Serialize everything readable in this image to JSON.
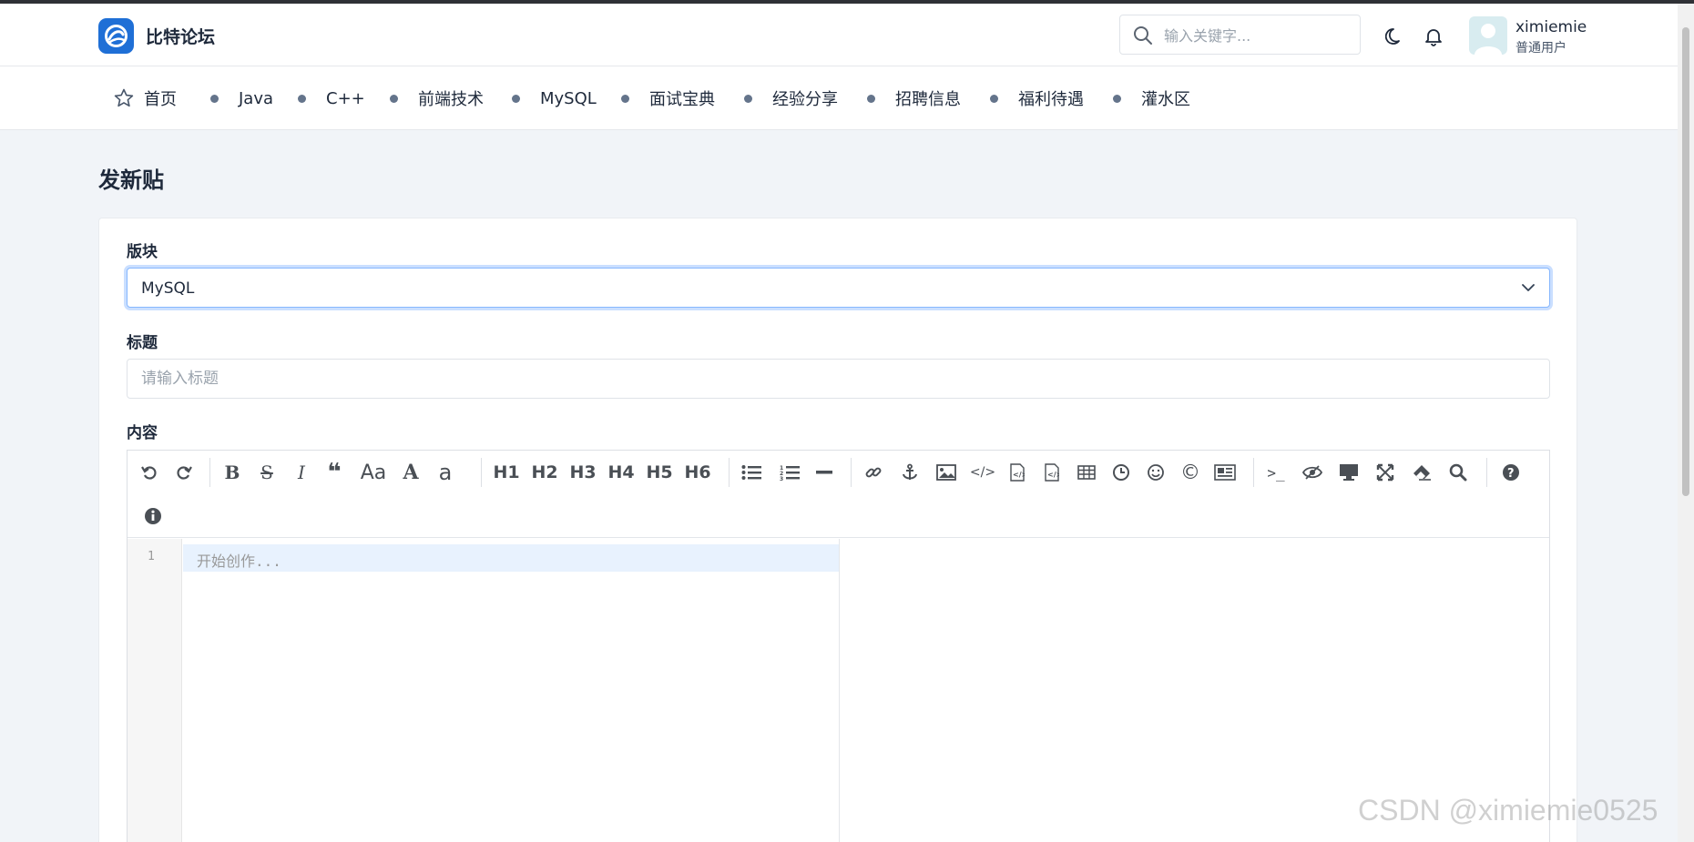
{
  "header": {
    "brand": "比特论坛",
    "search_placeholder": "输入关键字...",
    "user": {
      "name": "ximiemie",
      "role": "普通用户"
    }
  },
  "nav": {
    "items": [
      {
        "label": "首页",
        "icon": "star-icon"
      },
      {
        "label": "Java"
      },
      {
        "label": "C++"
      },
      {
        "label": "前端技术"
      },
      {
        "label": "MySQL"
      },
      {
        "label": "面试宝典"
      },
      {
        "label": "经验分享"
      },
      {
        "label": "招聘信息"
      },
      {
        "label": "福利待遇"
      },
      {
        "label": "灌水区"
      }
    ]
  },
  "page": {
    "title": "发新贴"
  },
  "form": {
    "board_label": "版块",
    "board_value": "MySQL",
    "title_label": "标题",
    "title_placeholder": "请输入标题",
    "content_label": "内容",
    "editor": {
      "line_number": "1",
      "placeholder": "开始创作...",
      "toolbar": [
        "undo",
        "redo",
        "bold",
        "strikethrough",
        "italic",
        "quote",
        "uppercase",
        "lowercase-a",
        "lowercase",
        "h1",
        "h2",
        "h3",
        "h4",
        "h5",
        "h6",
        "unordered-list",
        "ordered-list",
        "horizontal-rule",
        "link",
        "anchor",
        "image",
        "code",
        "preformatted-code",
        "code-block",
        "table",
        "datetime",
        "emoji",
        "html-entities",
        "pagebreak",
        "terminal",
        "preview",
        "watch",
        "fullscreen",
        "clear",
        "search",
        "help",
        "info"
      ],
      "heading_labels": [
        "H1",
        "H2",
        "H3",
        "H4",
        "H5",
        "H6"
      ],
      "text_labels": {
        "uppercase": "Aa",
        "lowercase_a": "A",
        "lowercase": "a"
      }
    }
  },
  "watermark": "CSDN @ximiemie0525",
  "colors": {
    "accent": "#1f6fd6",
    "background": "#f1f4f8",
    "focus": "#86b7fe"
  }
}
